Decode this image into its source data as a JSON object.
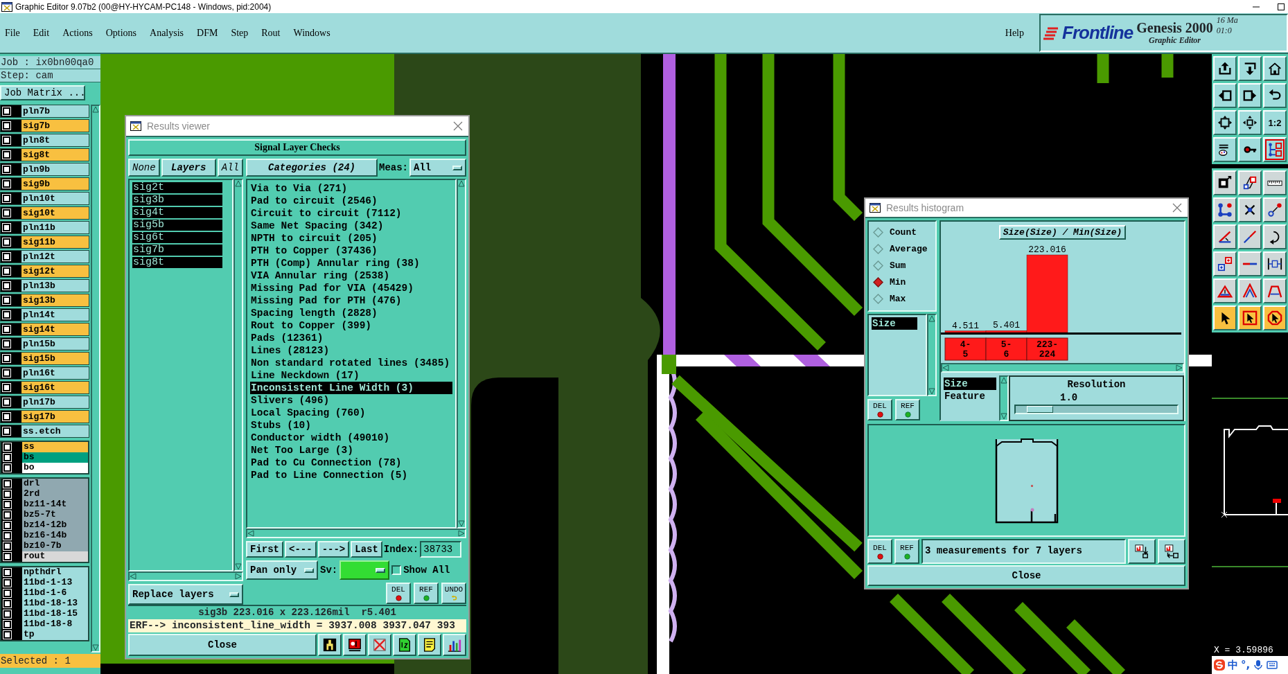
{
  "window": {
    "title": "Graphic Editor 9.07b2 (00@HY-HYCAM-PC148 - Windows, pid:2004)"
  },
  "menu": {
    "items": [
      "File",
      "Edit",
      "Actions",
      "Options",
      "Analysis",
      "DFM",
      "Step",
      "Rout",
      "Windows"
    ],
    "help": "Help"
  },
  "brand": {
    "logo": "Frontline",
    "product": "Genesis 2000",
    "subtitle": "Graphic Editor",
    "date": "16 Ma",
    "time": "01:0"
  },
  "job_panel": {
    "job": "Job : ix0bn00qa0",
    "step": "Step: cam",
    "matrix_button": "Job Matrix ...",
    "selected_count": "Selected : 1",
    "layer_groups": [
      {
        "kind": "board",
        "layers": [
          {
            "name": "pln7b",
            "color": "#a0dcdc",
            "checked": false
          },
          {
            "name": "sig7b",
            "color": "#f8c040",
            "checked": false
          },
          {
            "name": "pln8t",
            "color": "#a0dcdc",
            "checked": false
          },
          {
            "name": "sig8t",
            "color": "#f8c040",
            "checked": false
          },
          {
            "name": "pln9b",
            "color": "#a0dcdc",
            "checked": false
          },
          {
            "name": "sig9b",
            "color": "#f8c040",
            "checked": false
          },
          {
            "name": "pln10t",
            "color": "#a0dcdc",
            "checked": false
          },
          {
            "name": "sig10t",
            "color": "#f8c040",
            "checked": false
          },
          {
            "name": "pln11b",
            "color": "#a0dcdc",
            "checked": false
          },
          {
            "name": "sig11b",
            "color": "#f8c040",
            "checked": false
          },
          {
            "name": "pln12t",
            "color": "#a0dcdc",
            "checked": false
          },
          {
            "name": "sig12t",
            "color": "#f8c040",
            "checked": false
          },
          {
            "name": "pln13b",
            "color": "#a0dcdc",
            "checked": false
          },
          {
            "name": "sig13b",
            "color": "#f8c040",
            "checked": false
          },
          {
            "name": "pln14t",
            "color": "#a0dcdc",
            "checked": false
          },
          {
            "name": "sig14t",
            "color": "#f8c040",
            "checked": false
          },
          {
            "name": "pln15b",
            "color": "#a0dcdc",
            "checked": false
          },
          {
            "name": "sig15b",
            "color": "#f8c040",
            "checked": false
          },
          {
            "name": "pln16t",
            "color": "#a0dcdc",
            "checked": false
          },
          {
            "name": "sig16t",
            "color": "#f8c040",
            "checked": false
          },
          {
            "name": "pln17b",
            "color": "#a0dcdc",
            "checked": false
          },
          {
            "name": "sig17b",
            "color": "#f8c040",
            "checked": false
          },
          {
            "name": "ss.etch",
            "color": "#a0dcdc",
            "checked": false
          }
        ]
      },
      {
        "kind": "compact",
        "layers": [
          {
            "name": "ss",
            "color": "#f8c040",
            "checked": false
          },
          {
            "name": "bs",
            "color": "#00a080",
            "checked": false
          },
          {
            "name": "bo",
            "color": "#ffffff",
            "checked": false
          }
        ]
      },
      {
        "kind": "compact",
        "layers": [
          {
            "name": "drl",
            "color": "#90a8b0",
            "checked": false
          },
          {
            "name": "2rd",
            "color": "#90a8b0",
            "checked": false
          },
          {
            "name": "bz11-14t",
            "color": "#90a8b0",
            "checked": false
          },
          {
            "name": "bz5-7t",
            "color": "#90a8b0",
            "checked": false
          },
          {
            "name": "bz14-12b",
            "color": "#90a8b0",
            "checked": false
          },
          {
            "name": "bz16-14b",
            "color": "#90a8b0",
            "checked": false
          },
          {
            "name": "bz10-7b",
            "color": "#90a8b0",
            "checked": false
          },
          {
            "name": "rout",
            "color": "#d8d8d8",
            "checked": false
          }
        ]
      },
      {
        "kind": "compact",
        "layers": [
          {
            "name": "npthdrl",
            "color": "#a0dcdc",
            "checked": false
          },
          {
            "name": "11bd-1-13",
            "color": "#a0dcdc",
            "checked": false
          },
          {
            "name": "11bd-1-6",
            "color": "#a0dcdc",
            "checked": false
          },
          {
            "name": "11bd-18-13",
            "color": "#a0dcdc",
            "checked": false
          },
          {
            "name": "11bd-18-15",
            "color": "#a0dcdc",
            "checked": false
          },
          {
            "name": "11bd-18-8",
            "color": "#a0dcdc",
            "checked": false
          },
          {
            "name": "tp",
            "color": "#a0dcdc",
            "checked": false
          }
        ]
      }
    ]
  },
  "tool_groups": [
    {
      "tools": [
        {
          "kind": "tool",
          "selected": false
        },
        {
          "kind": "tool",
          "selected": false
        },
        {
          "kind": "tool",
          "selected": false
        },
        {
          "kind": "tool",
          "selected": false
        },
        {
          "kind": "tool",
          "selected": false
        },
        {
          "kind": "tool",
          "selected": false
        },
        {
          "kind": "tool",
          "selected": false
        },
        {
          "kind": "tool",
          "selected": false
        },
        {
          "kind": "tool",
          "label": "1:2",
          "selected": false
        },
        {
          "kind": "tool",
          "selected": false
        },
        {
          "kind": "tool",
          "selected": false
        },
        {
          "kind": "tool",
          "selected": true
        }
      ]
    },
    {
      "tools": [
        {
          "kind": "tool",
          "selected": false
        },
        {
          "kind": "tool",
          "selected": false
        },
        {
          "kind": "tool",
          "selected": false
        },
        {
          "kind": "tool",
          "selected": false
        },
        {
          "kind": "tool",
          "selected": false
        },
        {
          "kind": "tool",
          "selected": false
        },
        {
          "kind": "tool",
          "selected": false
        },
        {
          "kind": "tool",
          "selected": false
        },
        {
          "kind": "tool",
          "selected": false
        },
        {
          "kind": "tool",
          "selected": false
        },
        {
          "kind": "tool",
          "selected": false
        },
        {
          "kind": "tool",
          "selected": false
        },
        {
          "kind": "tool",
          "selected": false
        },
        {
          "kind": "tool",
          "selected": false
        },
        {
          "kind": "tool",
          "selected": false
        },
        {
          "kind": "pointer",
          "selected": false
        },
        {
          "kind": "pointer",
          "selected": false
        },
        {
          "kind": "pointer",
          "selected": false
        }
      ]
    }
  ],
  "status": {
    "coordinate": "X = 3.59896"
  },
  "ime": {
    "mode": "中",
    "punctuation": "°,"
  },
  "results_viewer": {
    "title": "Results viewer",
    "header": "Signal Layer Checks",
    "none_button": "None",
    "layers_label": "Layers",
    "all_button": "All",
    "layers": [
      {
        "name": "sig2t",
        "selected": true
      },
      {
        "name": "sig3b",
        "selected": true
      },
      {
        "name": "sig4t",
        "selected": true
      },
      {
        "name": "sig5b",
        "selected": true
      },
      {
        "name": "sig6t",
        "selected": true
      },
      {
        "name": "sig7b",
        "selected": true
      },
      {
        "name": "sig8t",
        "selected": true
      }
    ],
    "categories_button": "Categories (24)",
    "meas_label": "Meas:",
    "meas_value": "All",
    "categories": [
      {
        "name": "Via to Via (271)",
        "selected": false
      },
      {
        "name": "Pad to circuit (2546)",
        "selected": false
      },
      {
        "name": "Circuit to circuit (7112)",
        "selected": false
      },
      {
        "name": "Same Net Spacing (342)",
        "selected": false
      },
      {
        "name": "NPTH to circuit (205)",
        "selected": false
      },
      {
        "name": "PTH to Copper (37436)",
        "selected": false
      },
      {
        "name": "PTH (Comp) Annular ring (38)",
        "selected": false
      },
      {
        "name": "VIA Annular ring (2538)",
        "selected": false
      },
      {
        "name": "Missing Pad for VIA (45429)",
        "selected": false
      },
      {
        "name": "Missing Pad for PTH (476)",
        "selected": false
      },
      {
        "name": "Spacing length (2828)",
        "selected": false
      },
      {
        "name": "Rout to Copper (399)",
        "selected": false
      },
      {
        "name": "Pads (12361)",
        "selected": false
      },
      {
        "name": "Lines (28123)",
        "selected": false
      },
      {
        "name": "Non standard rotated lines (3485)",
        "selected": false
      },
      {
        "name": "Line Neckdown (17)",
        "selected": false
      },
      {
        "name": "Inconsistent Line Width (3)",
        "selected": true
      },
      {
        "name": "Slivers (496)",
        "selected": false
      },
      {
        "name": "Local Spacing (760)",
        "selected": false
      },
      {
        "name": "Stubs (10)",
        "selected": false
      },
      {
        "name": "Conductor width (49010)",
        "selected": false
      },
      {
        "name": "Net Too Large (3)",
        "selected": false
      },
      {
        "name": "Pad to Cu Connection (78)",
        "selected": false
      },
      {
        "name": "Pad to Line Connection (5)",
        "selected": false
      }
    ],
    "nav": [
      "First",
      "<---",
      "--->",
      "Last"
    ],
    "index_label": "Index:",
    "index_value": "38733",
    "pan_mode": "Pan only",
    "sv_label": "Sv:",
    "show_all": {
      "label": "Show All",
      "checked": false
    },
    "replace_mode": "Replace layers",
    "edit_buttons": [
      "DEL",
      "REF",
      "UNDO"
    ],
    "info": "sig3b 223.016 x 223.126mil  r5.401",
    "erf": "ERF--> inconsistent_line_width = 3937.008 3937.047 393",
    "close": "Close"
  },
  "results_histogram": {
    "title": "Results histogram",
    "modes": [
      {
        "label": "Count",
        "selected": false
      },
      {
        "label": "Average",
        "selected": false
      },
      {
        "label": "Sum",
        "selected": false
      },
      {
        "label": "Min",
        "selected": true
      },
      {
        "label": "Max",
        "selected": false
      }
    ],
    "fields": [
      {
        "name": "Size",
        "selected": true
      }
    ],
    "field_buttons": [
      "DEL",
      "REF"
    ],
    "chart_data": {
      "type": "bar",
      "title": "Size(Size) / Min(Size)",
      "categories": [
        "4-5",
        "5-6",
        "223-224"
      ],
      "values": [
        4.511,
        5.401,
        223.016
      ],
      "data_labels": true
    },
    "axes": [
      {
        "name": "Size",
        "selected": true
      },
      {
        "name": "Feature",
        "selected": false
      }
    ],
    "resolution": {
      "label": "Resolution",
      "value": "1.0",
      "level": 0.08
    },
    "bottom_buttons": [
      "DEL",
      "REF"
    ],
    "summary": "3 measurements for 7 layers",
    "close": "Close"
  }
}
